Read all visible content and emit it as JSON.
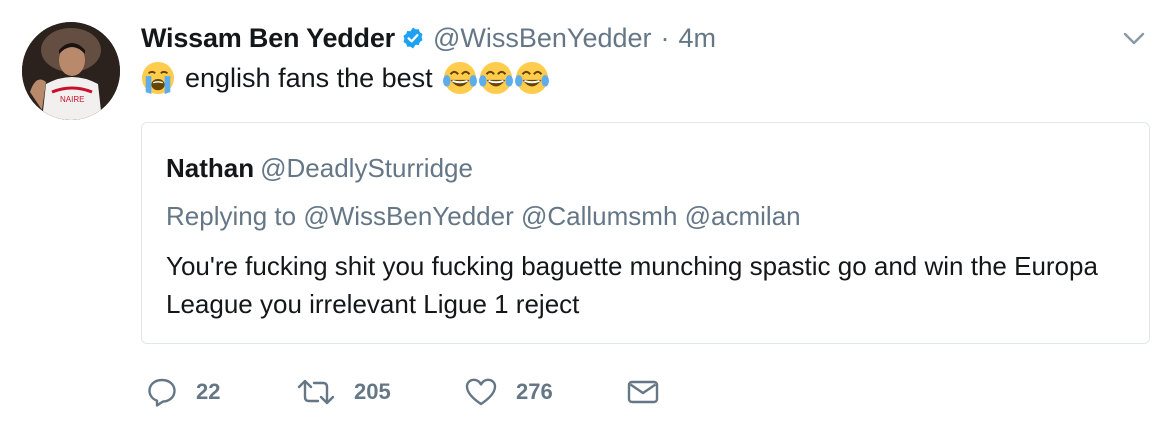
{
  "tweet": {
    "author": {
      "display_name": "Wissam Ben Yedder",
      "handle": "@WissBenYedder",
      "verified": true,
      "avatar_icon": "avatar-photo"
    },
    "separator": "·",
    "timestamp": "4m",
    "text": "english fans the best",
    "lead_emoji": "loudly-crying-face",
    "trailing_emojis": [
      "face-with-tears-of-joy",
      "face-with-tears-of-joy",
      "face-with-tears-of-joy"
    ],
    "menu_icon": "chevron-down-icon"
  },
  "quoted_tweet": {
    "display_name": "Nathan",
    "handle": "@DeadlySturridge",
    "replying_prefix": "Replying to",
    "replying_to": [
      "@WissBenYedder",
      "@Callumsmh",
      "@acmilan"
    ],
    "body": "You're fucking shit you fucking baguette munching spastic go and win the Europa League you irrelevant Ligue 1 reject"
  },
  "actions": {
    "reply": {
      "icon": "reply-icon",
      "count": "22"
    },
    "retweet": {
      "icon": "retweet-icon",
      "count": "205"
    },
    "like": {
      "icon": "heart-icon",
      "count": "276"
    },
    "direct_message": {
      "icon": "envelope-icon"
    }
  },
  "colors": {
    "text": "#14171a",
    "secondary": "#657786",
    "verified": "#1da1f2",
    "border": "#e1e8ed"
  }
}
